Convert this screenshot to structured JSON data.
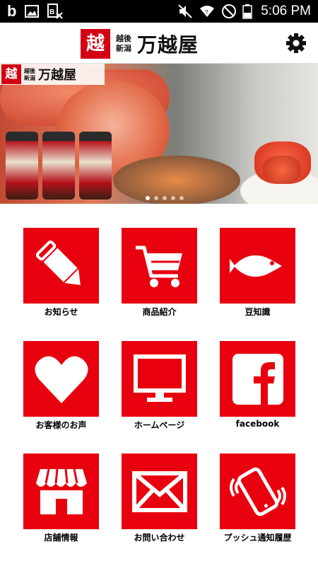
{
  "status_bar": {
    "left_icons": [
      "b",
      "image-icon",
      "bx-icon"
    ],
    "time": "5:06 PM"
  },
  "header": {
    "brand_sub_line1": "越後",
    "brand_sub_line2": "新潟",
    "brand_name": "万越屋",
    "brand_seal": "越",
    "settings_icon": "gear-icon"
  },
  "banner": {
    "logo_seal": "越",
    "logo_sub_line1": "越後",
    "logo_sub_line2": "新潟",
    "logo_name": "万越屋",
    "slide_count": 5,
    "active_slide": 0
  },
  "menu": [
    {
      "label": "お知らせ",
      "icon": "pencil-icon"
    },
    {
      "label": "商品紹介",
      "icon": "shopping-cart-icon"
    },
    {
      "label": "豆知識",
      "icon": "fish-icon"
    },
    {
      "label": "お客様のお声",
      "icon": "heart-icon"
    },
    {
      "label": "ホームページ",
      "icon": "monitor-icon"
    },
    {
      "label": "facebook",
      "icon": "facebook-icon"
    },
    {
      "label": "店舗情報",
      "icon": "shop-icon"
    },
    {
      "label": "お問い合わせ",
      "icon": "envelope-icon"
    },
    {
      "label": "プッシュ通知履歴",
      "icon": "vibrating-phone-icon"
    }
  ],
  "colors": {
    "tile": "#e8000f",
    "brand_red": "#d30012",
    "status_bar": "#000000"
  }
}
